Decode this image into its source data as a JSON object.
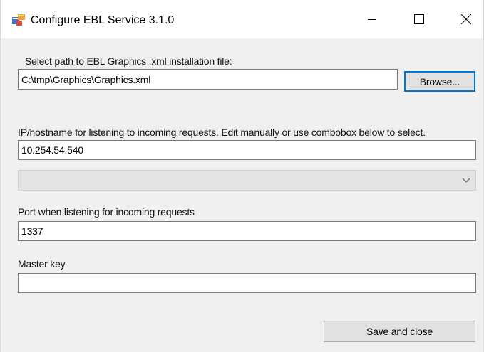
{
  "window": {
    "title": "Configure EBL Service 3.1.0",
    "controls": {
      "minimize": "minimize-icon",
      "maximize": "maximize-icon",
      "close": "close-icon"
    }
  },
  "form": {
    "path_label": "Select path to EBL Graphics .xml installation file:",
    "path_value": "C:\\tmp\\Graphics\\Graphics.xml",
    "browse_label": "Browse...",
    "ip_label": "IP/hostname for listening to incoming requests. Edit manually or use combobox below to select.",
    "ip_value": "10.254.54.540",
    "ip_combo_value": "",
    "port_label": "Port when listening for incoming requests",
    "port_value": "1337",
    "master_key_label": "Master key",
    "master_key_value": "",
    "save_label": "Save and close"
  }
}
